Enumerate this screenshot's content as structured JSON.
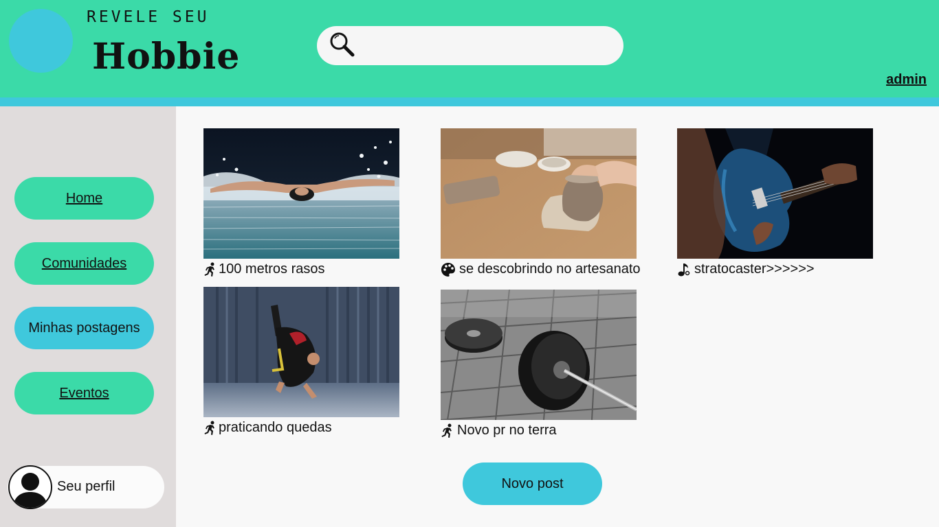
{
  "header": {
    "tagline": "REVELE SEU",
    "brand": "Hobbie",
    "search": {
      "placeholder": "",
      "value": ""
    },
    "user": "admin"
  },
  "sidebar": {
    "items": [
      {
        "label": "Home",
        "active": false
      },
      {
        "label": "Comunidades",
        "active": false
      },
      {
        "label": "Minhas postagens",
        "active": true
      },
      {
        "label": "Eventos",
        "active": false
      }
    ],
    "profile_label": "Seu perfil"
  },
  "posts": [
    {
      "caption": "100 metros rasos",
      "icon": "running-person-icon",
      "image": "swimmer-butterfly-stroke"
    },
    {
      "caption": "se descobrindo no artesanato",
      "icon": "palette-icon",
      "image": "pottery-clay-bowl"
    },
    {
      "caption": "stratocaster>>>>>>",
      "icon": "music-note-icon",
      "image": "blue-electric-guitar"
    },
    {
      "caption": "praticando quedas",
      "icon": "running-person-icon",
      "image": "judo-breakfall"
    },
    {
      "caption": "Novo pr no terra",
      "icon": "running-person-icon",
      "image": "barbell-weight-plates"
    }
  ],
  "new_post_label": "Novo post",
  "colors": {
    "header": "#3bdaa8",
    "accent_strip": "#3fc8dc",
    "sidebar": "#e0dcdc",
    "button_green": "#3bdaa8",
    "button_blue": "#3fc8dc",
    "page": "#f8f8f8"
  }
}
